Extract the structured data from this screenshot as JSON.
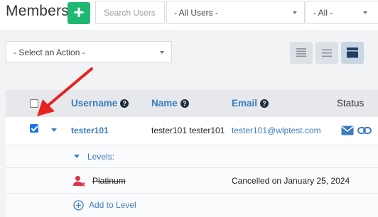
{
  "header": {
    "title": "Members",
    "add_button": "+",
    "search_placeholder": "Search Users",
    "users_filter": "- All Users -",
    "status_filter": "- All -"
  },
  "toolbar": {
    "action_select": "- Select an Action -",
    "view_buttons": [
      "list-compact-icon",
      "list-icon",
      "list-expanded-icon"
    ]
  },
  "table": {
    "columns": {
      "username": "Username",
      "name": "Name",
      "email": "Email",
      "status": "Status"
    },
    "help_glyph": "?",
    "member": {
      "checked": true,
      "username": "tester101",
      "name": "tester101 tester101",
      "email": "tester101@wlptest.com"
    },
    "levels_label": "Levels:",
    "level": {
      "name": "Platinum",
      "status": "Cancelled on January 25, 2024"
    },
    "add_level_label": "Add to Level"
  },
  "colors": {
    "accent": "#3a7cbf",
    "add_button": "#1fb872",
    "arrow": "#e8231f",
    "cancelled_icon": "#d9344a"
  }
}
